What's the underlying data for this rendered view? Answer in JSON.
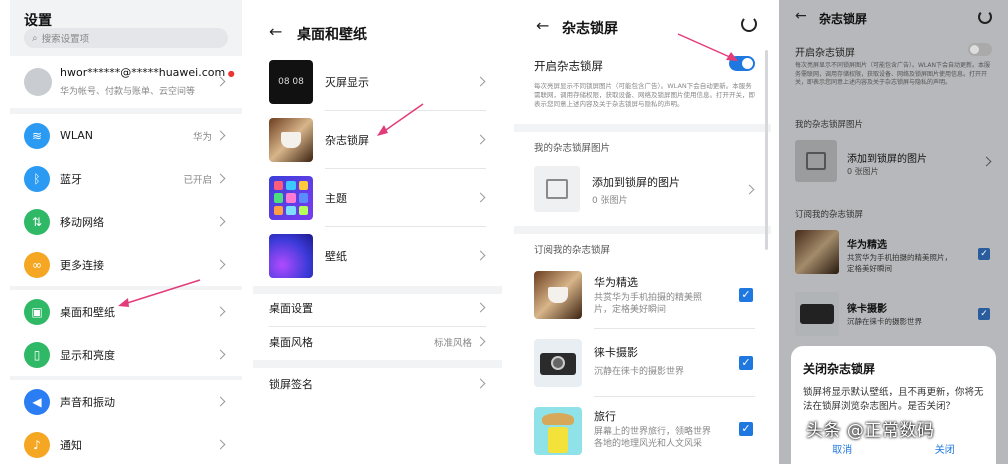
{
  "settings": {
    "title": "设置",
    "search_placeholder": "搜索设置项",
    "account_name": "hwor******@*****huawei.com",
    "account_sub": "华为帐号、付款与账单、云空间等",
    "items": [
      {
        "label": "WLAN",
        "value": "华为",
        "icon": "wifi-icon",
        "color": "#2b9af3"
      },
      {
        "label": "蓝牙",
        "value": "已开启",
        "icon": "bluetooth-icon",
        "color": "#2b9af3"
      },
      {
        "label": "移动网络",
        "value": "",
        "icon": "signal-icon",
        "color": "#2fb865"
      },
      {
        "label": "更多连接",
        "value": "",
        "icon": "link-icon",
        "color": "#f5a623"
      },
      {
        "label": "桌面和壁纸",
        "value": "",
        "icon": "picture-icon",
        "color": "#2fb865"
      },
      {
        "label": "显示和亮度",
        "value": "",
        "icon": "display-icon",
        "color": "#2fb865"
      },
      {
        "label": "声音和振动",
        "value": "",
        "icon": "speaker-icon",
        "color": "#2b7df3"
      },
      {
        "label": "通知",
        "value": "",
        "icon": "bell-icon",
        "color": "#f5a623"
      }
    ]
  },
  "desktop": {
    "title": "桌面和壁纸",
    "items": [
      {
        "label": "灭屏显示",
        "thumb_text": "08 08"
      },
      {
        "label": "杂志锁屏"
      },
      {
        "label": "主题"
      },
      {
        "label": "壁纸"
      }
    ],
    "plain_items": [
      {
        "label": "桌面设置",
        "value": ""
      },
      {
        "label": "桌面风格",
        "value": "标准风格"
      },
      {
        "label": "锁屏签名",
        "value": ""
      }
    ]
  },
  "magazine": {
    "title": "杂志锁屏",
    "toggle_label": "开启杂志锁屏",
    "desc": "每次亮屏显示不同锁屏图片（可能包含广告）。WLAN下会自动更新。本服务需联网，调用存储权限，获取设备、网络及锁屏图片使用信息。打开开关，即表示您同意上述内容及关于杂志锁屏与隐私的声明。",
    "my_pics_header": "我的杂志锁屏图片",
    "add_label": "添加到锁屏的图片",
    "add_count": "0 张图片",
    "subs_header": "订阅我的杂志锁屏",
    "subs": [
      {
        "title": "华为精选",
        "desc": "共赏华为手机拍摄的精美照片，定格美好瞬间"
      },
      {
        "title": "徕卡摄影",
        "desc": "沉静在徕卡的摄影世界"
      },
      {
        "title": "旅行",
        "desc": "屏幕上的世界旅行，领略世界各地的地理风光和人文风采"
      }
    ]
  },
  "dialog": {
    "title": "关闭杂志锁屏",
    "body": "锁屏将显示默认壁纸，且不再更新，你将无法在锁屏浏览杂志图片。是否关闭？",
    "cancel": "取消",
    "confirm": "关闭"
  },
  "watermark": "头条 @正常数码",
  "colors": {
    "accent": "#1f78e0",
    "arrow": "#e23c7a"
  }
}
